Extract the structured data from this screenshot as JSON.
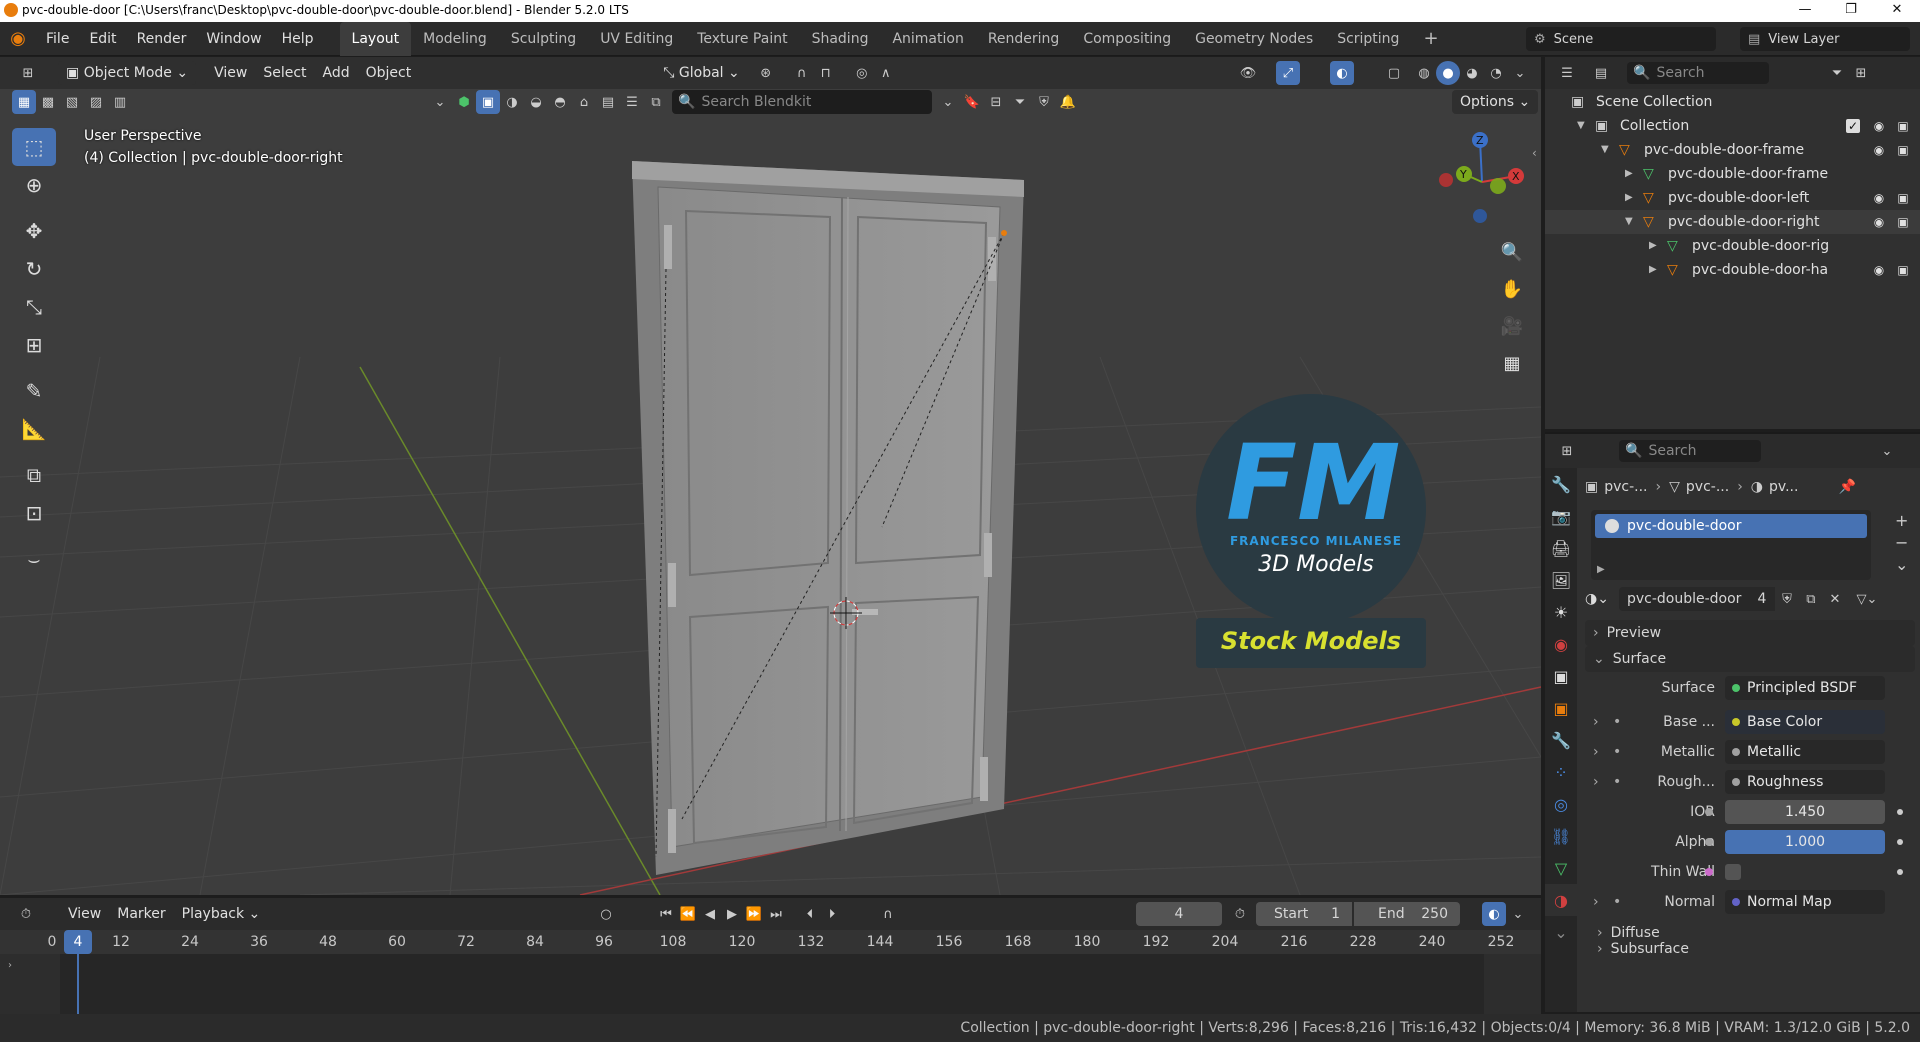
{
  "window": {
    "title": "pvc-double-door [C:\\Users\\franc\\Desktop\\pvc-double-door\\pvc-double-door.blend] - Blender 5.2.0 LTS",
    "minimize": "—",
    "maximize": "❐",
    "close": "✕"
  },
  "menu": [
    "File",
    "Edit",
    "Render",
    "Window",
    "Help"
  ],
  "workspaces": [
    "Layout",
    "Modeling",
    "Sculpting",
    "UV Editing",
    "Texture Paint",
    "Shading",
    "Animation",
    "Rendering",
    "Compositing",
    "Geometry Nodes",
    "Scripting"
  ],
  "scene": {
    "label": "Scene",
    "view_layer": "View Layer"
  },
  "viewport": {
    "mode": "Object Mode",
    "menus": [
      "View",
      "Select",
      "Add",
      "Object"
    ],
    "transform": "Global",
    "search_placeholder": "Search Blendkit",
    "options": "Options",
    "perspective": "User Perspective",
    "collection_info": "(4) Collection | pvc-double-door-right"
  },
  "gizmo": {
    "z": "Z",
    "y": "Y",
    "x": "X"
  },
  "watermark": {
    "fm": "FM",
    "name": "FRANCESCO MILANESE",
    "sub": "3D Models",
    "badge": "Stock Models"
  },
  "outliner": {
    "search_placeholder": "Search",
    "root": "Scene Collection",
    "collection": "Collection",
    "items": [
      {
        "label": "pvc-double-door-frame",
        "level": 1
      },
      {
        "label": "pvc-double-door-frame",
        "level": 2
      },
      {
        "label": "pvc-double-door-left",
        "level": 1
      },
      {
        "label": "pvc-double-door-right",
        "level": 1
      },
      {
        "label": "pvc-double-door-rig",
        "level": 2
      },
      {
        "label": "pvc-double-door-ha",
        "level": 2
      }
    ]
  },
  "properties": {
    "search_placeholder": "Search",
    "breadcrumb": [
      "pvc-...",
      "pvc-...",
      "pv..."
    ],
    "material_slot": "pvc-double-door",
    "material_name": "pvc-double-door",
    "user_count": "4",
    "panels": {
      "preview": "Preview",
      "surface": "Surface",
      "diffuse": "Diffuse",
      "subsurface": "Subsurface"
    },
    "rows": [
      {
        "label": "Surface",
        "value": "Principled BSDF",
        "socket": "#4cc36a"
      },
      {
        "label": "Base ...",
        "value": "Base Color",
        "socket": "#c7c729"
      },
      {
        "label": "Metallic",
        "value": "Metallic",
        "socket": "#a1a1a1"
      },
      {
        "label": "Rough...",
        "value": "Roughness",
        "socket": "#a1a1a1"
      },
      {
        "label": "IOR",
        "value": "1.450",
        "socket": "#a1a1a1"
      },
      {
        "label": "Alpha",
        "value": "1.000",
        "socket": "#a1a1a1"
      },
      {
        "label": "Thin Wall",
        "value": "",
        "socket": "#cc6acb"
      },
      {
        "label": "Normal",
        "value": "Normal Map",
        "socket": "#6363c7"
      }
    ]
  },
  "timeline": {
    "menus": [
      "View",
      "Marker",
      "Playback"
    ],
    "current_frame": "4",
    "start_label": "Start",
    "start": "1",
    "end_label": "End",
    "end": "250",
    "ticks": [
      "0",
      "12",
      "24",
      "36",
      "48",
      "60",
      "72",
      "84",
      "96",
      "108",
      "120",
      "132",
      "144",
      "156",
      "168",
      "180",
      "192",
      "204",
      "216",
      "228",
      "240",
      "252"
    ]
  },
  "statusbar": {
    "text": "Collection | pvc-double-door-right | Verts:8,296 | Faces:8,216 | Tris:16,432 | Objects:0/4 | Memory: 36.8 MiB | VRAM: 1.3/12.0 GiB | 5.2.0"
  },
  "colors": {
    "accent": "#4772b3",
    "selected_orange": "#e87d0d"
  }
}
